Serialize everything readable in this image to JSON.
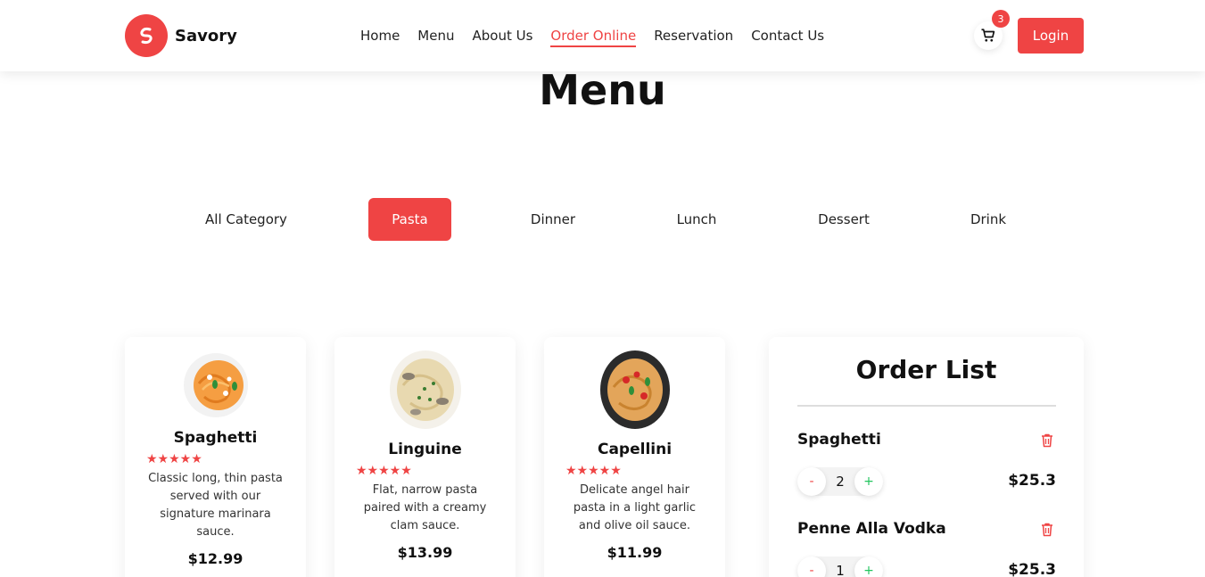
{
  "brand": {
    "name": "Savory"
  },
  "nav": {
    "items": [
      {
        "label": "Home"
      },
      {
        "label": "Menu"
      },
      {
        "label": "About Us"
      },
      {
        "label": "Order Online"
      },
      {
        "label": "Reservation"
      },
      {
        "label": "Contact Us"
      }
    ],
    "active": "Order Online"
  },
  "cart": {
    "count": "3",
    "icon": "cart-icon"
  },
  "login_label": "Login",
  "page_title": "Menu",
  "categories": [
    {
      "label": "All Category"
    },
    {
      "label": "Pasta"
    },
    {
      "label": "Dinner"
    },
    {
      "label": "Lunch"
    },
    {
      "label": "Dessert"
    },
    {
      "label": "Drink"
    }
  ],
  "active_category": "Pasta",
  "menu_items": [
    {
      "name": "Spaghetti",
      "rating": 5,
      "description": "Classic long, thin pasta served with our signature marinara sauce.",
      "price": "$12.99"
    },
    {
      "name": "Linguine",
      "rating": 5,
      "description": "Flat, narrow pasta paired with a creamy clam sauce.",
      "price": "$13.99"
    },
    {
      "name": "Capellini",
      "rating": 5,
      "description": "Delicate angel hair pasta in a light garlic and olive oil sauce.",
      "price": "$11.99"
    }
  ],
  "order_list": {
    "title": "Order List",
    "items": [
      {
        "name": "Spaghetti",
        "quantity": "2",
        "price": "$25.3"
      },
      {
        "name": "Penne Alla Vodka",
        "quantity": "1",
        "price": "$25.3"
      }
    ],
    "minus_label": "-",
    "plus_label": "+"
  },
  "colors": {
    "accent": "#ef4444",
    "plus": "#22c55e"
  }
}
